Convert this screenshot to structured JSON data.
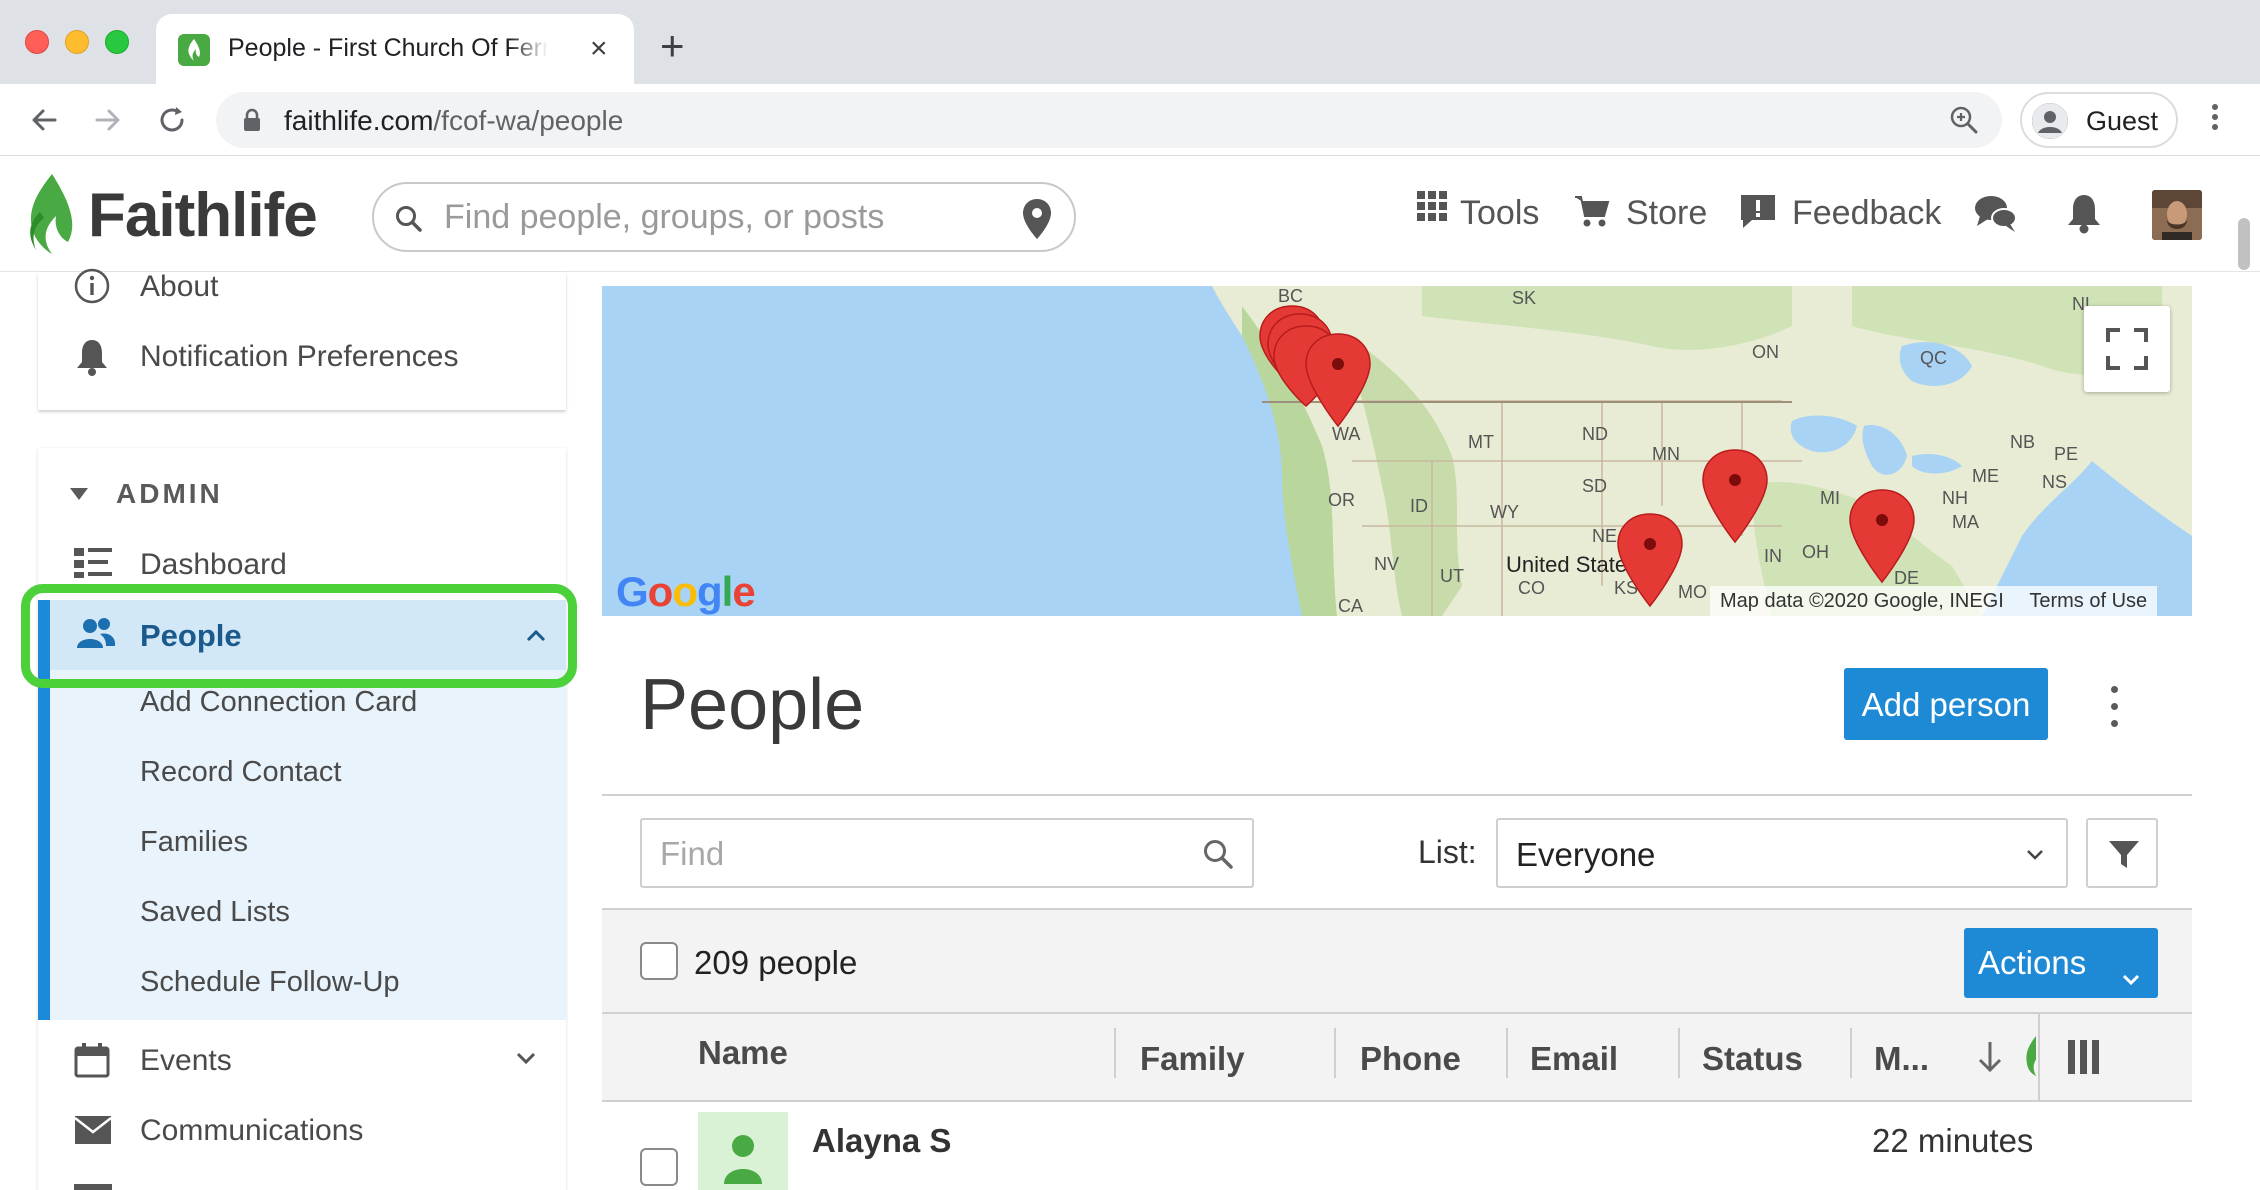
{
  "browser": {
    "tab_title": "People - First Church Of Ferndale",
    "url_host": "faithlife.com",
    "url_path": "/fcof-wa/people",
    "profile_label": "Guest"
  },
  "site_header": {
    "brand": "Faithlife",
    "search_placeholder": "Find people, groups, or posts",
    "nav": {
      "tools": "Tools",
      "store": "Store",
      "feedback": "Feedback"
    }
  },
  "sidebar": {
    "top_items": [
      {
        "label": "About",
        "icon": "info-icon"
      },
      {
        "label": "Notification Preferences",
        "icon": "bell-icon"
      }
    ],
    "admin_heading": "ADMIN",
    "admin_items": {
      "dashboard": "Dashboard",
      "people": "People",
      "events": "Events",
      "communications": "Communications"
    },
    "people_subitems": [
      "Add Connection Card",
      "Record Contact",
      "Families",
      "Saved Lists",
      "Schedule Follow-Up"
    ]
  },
  "map": {
    "labels": [
      "BC",
      "SK",
      "NL",
      "ON",
      "QC",
      "WA",
      "MT",
      "ND",
      "MN",
      "NB",
      "PE",
      "NS",
      "ME",
      "OR",
      "ID",
      "SD",
      "WY",
      "MI",
      "NH",
      "MA",
      "NE",
      "NV",
      "UT",
      "IN",
      "OH",
      "United States",
      "CO",
      "KS",
      "MO",
      "DE",
      "CA"
    ],
    "attribution": "Map data ©2020 Google, INEGI",
    "terms": "Terms of Use",
    "google_logo": "Google",
    "pin_color": "#e53935"
  },
  "main": {
    "title": "People",
    "add_button": "Add person",
    "find_placeholder": "Find",
    "list_label": "List:",
    "list_value": "Everyone",
    "count_label": "209 people",
    "actions_button": "Actions",
    "columns": [
      "Name",
      "Family",
      "Phone",
      "Email",
      "Status",
      "M..."
    ],
    "rows": [
      {
        "name": "Alayna S",
        "time": "22 minutes"
      }
    ]
  },
  "colors": {
    "accent_blue": "#1e8ad6",
    "brand_green": "#49a942",
    "highlight_green": "#4cd13a",
    "selected_bg": "#e8f3fb"
  }
}
